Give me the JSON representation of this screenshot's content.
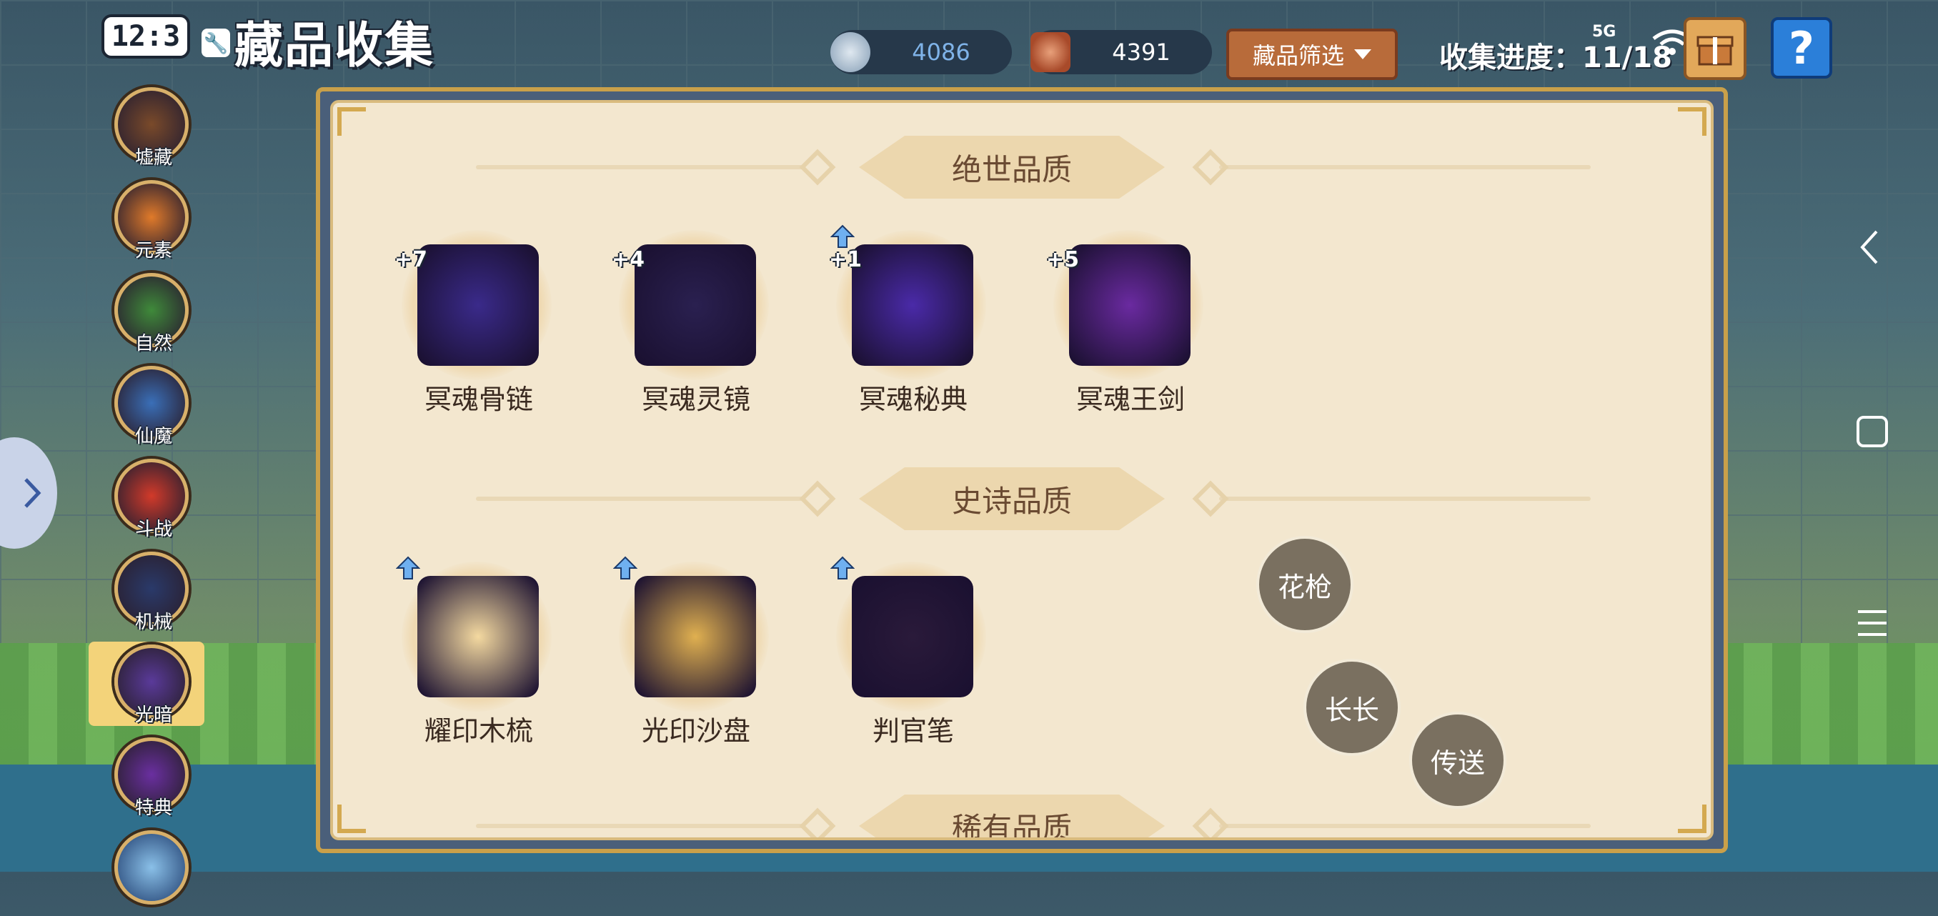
{
  "status_bar": {
    "time": "12:3",
    "network": "5G"
  },
  "header": {
    "title": "藏品收集",
    "resource_coins": "4086",
    "resource_gems": "4391",
    "filter_label": "藏品筛选",
    "progress_text": "收集进度：11/18",
    "help_label": "?"
  },
  "sidebar": {
    "items": [
      {
        "label": "墟藏",
        "icon": "treasure-chest-icon",
        "color": "#7a4a2a"
      },
      {
        "label": "元素",
        "icon": "flame-icon",
        "color": "#e07a2a"
      },
      {
        "label": "自然",
        "icon": "tree-icon",
        "color": "#3f8a3a"
      },
      {
        "label": "仙魔",
        "icon": "winged-gem-icon",
        "color": "#3a6fb8"
      },
      {
        "label": "斗战",
        "icon": "boxing-glove-icon",
        "color": "#d23a2a"
      },
      {
        "label": "机械",
        "icon": "mech-head-icon",
        "color": "#2a3a6a"
      },
      {
        "label": "光暗",
        "icon": "moon-orb-icon",
        "color": "#5a3a9a",
        "selected": true
      },
      {
        "label": "特典",
        "icon": "purple-book-icon",
        "color": "#6a2fa0"
      }
    ]
  },
  "sections": [
    {
      "title": "绝世品质",
      "items": [
        {
          "name": "冥魂骨链",
          "badge": "+7",
          "icon": "skull-chain-icon",
          "color": "#3a2a8a"
        },
        {
          "name": "冥魂灵镜",
          "badge": "+4",
          "icon": "dark-mirror-icon",
          "color": "#2a2050"
        },
        {
          "name": "冥魂秘典",
          "badge": "+1",
          "upgrade": true,
          "icon": "dark-tome-icon",
          "color": "#4a2aa8"
        },
        {
          "name": "冥魂王剑",
          "badge": "+5",
          "icon": "dark-sword-icon",
          "color": "#6a2aa0"
        }
      ]
    },
    {
      "title": "史诗品质",
      "items": [
        {
          "name": "耀印木梳",
          "upgrade": true,
          "icon": "winged-comb-icon",
          "color": "#f4d9a0"
        },
        {
          "name": "光印沙盘",
          "upgrade": true,
          "icon": "hourglass-icon",
          "color": "#e0b050"
        },
        {
          "name": "判官笔",
          "upgrade": true,
          "icon": "dark-brush-icon",
          "color": "#2a1a3a"
        }
      ]
    },
    {
      "title": "稀有品质",
      "items": []
    }
  ],
  "floating_bubbles": [
    "花枪",
    "长长",
    "传送"
  ],
  "colors": {
    "panel_bg": "#f3e7cf",
    "banner_bg": "#ecd7ae",
    "banner_text": "#6a4a32",
    "filter_btn": "#b86b3a",
    "help_btn": "#2b7fd9"
  }
}
